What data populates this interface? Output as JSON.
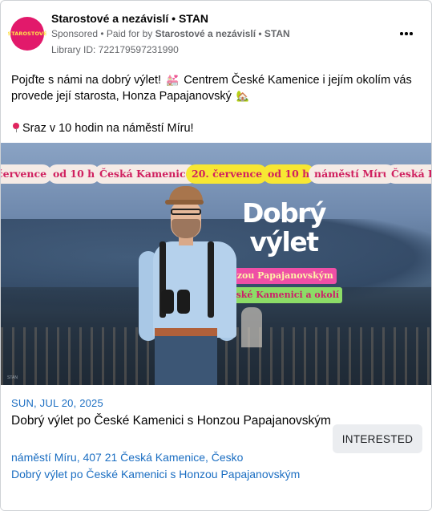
{
  "header": {
    "avatar_text": "STAROSTOVÉ",
    "page_name": "Starostové a nezávislí • STAN",
    "sponsored_label": "Sponsored",
    "paid_for_prefix": "• Paid for by",
    "paid_for_name": "Starostové a nezávislí • STAN",
    "library_id": "Library ID: 722179597231990",
    "more_icon": "more-horizontal-icon"
  },
  "post": {
    "line1_a": "Pojďte s námi na dobrý výlet!",
    "line1_emoji": "💒",
    "line1_b": "Centrem České Kamenice i jejím okolím vás provede její starosta, Honza Papajanovský",
    "line1_emoji2": "🏡",
    "line2": "Sraz v 10 hodin na náměstí Míru!"
  },
  "hero": {
    "ticker": [
      "července",
      "od 10 h",
      "Česká Kamenice",
      "20. července",
      "od 10 h",
      "náměstí Míru",
      "Česká Kam"
    ],
    "headline_1": "Dobrý",
    "headline_2": "výlet",
    "tag_1": "s Honzou Papajanovským",
    "tag_2": "po České Kamenici a okolí",
    "corner_mark": "STAN",
    "colors": {
      "pink": "#d0205f",
      "yellow": "#f7e733",
      "cream": "#f5ebe6",
      "green": "#8cdc67"
    }
  },
  "event": {
    "date": "SUN, JUL 20, 2025",
    "title": "Dobrý výlet po České Kamenici s Honzou Papajanovským",
    "place": "náměstí Míru, 407 21 Česká Kamenice, Česko",
    "link": "Dobrý výlet po České Kamenici s Honzou Papajanovským",
    "interested_label": "INTERESTED"
  }
}
